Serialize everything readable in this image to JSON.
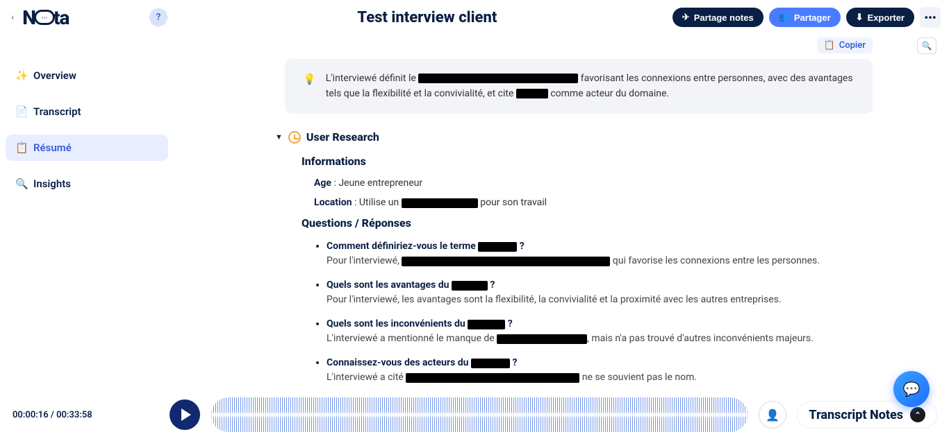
{
  "header": {
    "logo_left": "N",
    "logo_right": "ta",
    "help": "?",
    "title": "Test interview client",
    "partage_notes": "Partage notes",
    "partager": "Partager",
    "exporter": "Exporter",
    "more": "•••",
    "copier": "Copier"
  },
  "sidebar": {
    "items": [
      {
        "label": "Overview"
      },
      {
        "label": "Transcript"
      },
      {
        "label": "Résumé"
      },
      {
        "label": "Insights"
      }
    ]
  },
  "insight": {
    "pre": "L'interviewé définit le ",
    "mid": " favorisant les connexions entre personnes, avec des avantages tels que la flexibilité et la convivialité, et cite ",
    "post": " comme acteur du domaine."
  },
  "section": {
    "title": "User Research",
    "informations": "Informations",
    "age_label": "Age",
    "age_value": ": Jeune entrepreneur",
    "location_label": "Location",
    "location_pre": ": Utilise un ",
    "location_post": " pour son travail",
    "qr_title": "Questions / Réponses"
  },
  "qa": [
    {
      "q_pre": "Comment définiriez-vous le terme ",
      "q_post": " ?",
      "a_pre": "Pour l'interviewé, ",
      "a_post": " qui favorise les connexions entre les personnes."
    },
    {
      "q_pre": "Quels sont les avantages du ",
      "q_post": " ?",
      "a_pre": "Pour l'interviewé, les avantages sont la flexibilité, la convivialité et la proximité avec les autres entreprises.",
      "a_post": ""
    },
    {
      "q_pre": "Quels sont les inconvénients du ",
      "q_post": " ?",
      "a_pre": "L'interviewé a mentionné le manque de ",
      "a_post": ", mais n'a pas trouvé d'autres inconvénients majeurs."
    },
    {
      "q_pre": "Connaissez-vous des acteurs du ",
      "q_post": " ?",
      "a_pre": "L'interviewé a cité ",
      "a_post": " ne se souvient pas le nom."
    }
  ],
  "player": {
    "current": "00:00:16",
    "total": "00:33:58",
    "notes_label": "Transcript Notes"
  }
}
